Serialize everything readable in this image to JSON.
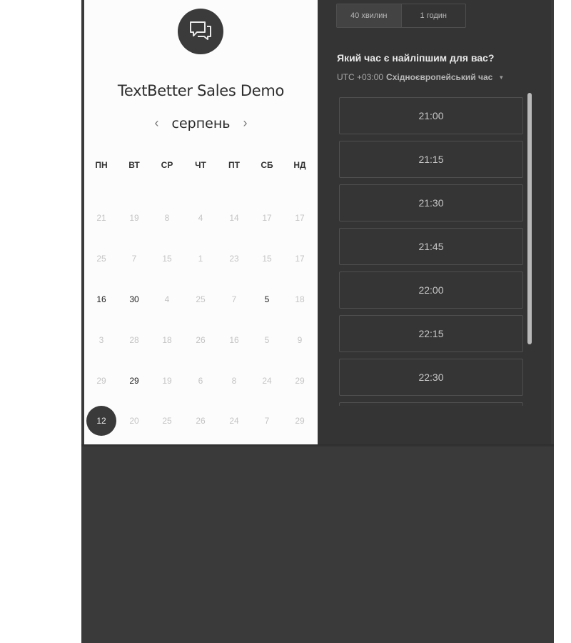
{
  "booking": {
    "company_title": "TextBetter Sales Demo",
    "logo_icon": "chat-bubbles-icon",
    "month": {
      "label": "серпень",
      "prev": "‹",
      "next": "›"
    },
    "weekdays": [
      "ПН",
      "ВТ",
      "СР",
      "ЧТ",
      "ПТ",
      "СБ",
      "НД"
    ],
    "weeks": [
      [
        {
          "d": "21"
        },
        {
          "d": "19"
        },
        {
          "d": "8"
        },
        {
          "d": "4"
        },
        {
          "d": "14"
        },
        {
          "d": "17"
        },
        {
          "d": "17"
        }
      ],
      [
        {
          "d": "25"
        },
        {
          "d": "7"
        },
        {
          "d": "15"
        },
        {
          "d": "1"
        },
        {
          "d": "23"
        },
        {
          "d": "15"
        },
        {
          "d": "17"
        }
      ],
      [
        {
          "d": "16",
          "available": true
        },
        {
          "d": "30",
          "available": true
        },
        {
          "d": "4"
        },
        {
          "d": "25"
        },
        {
          "d": "7"
        },
        {
          "d": "5",
          "available": true
        },
        {
          "d": "18"
        }
      ],
      [
        {
          "d": "3"
        },
        {
          "d": "28"
        },
        {
          "d": "18"
        },
        {
          "d": "26"
        },
        {
          "d": "16"
        },
        {
          "d": "5"
        },
        {
          "d": "9"
        }
      ],
      [
        {
          "d": "29"
        },
        {
          "d": "29",
          "available": true
        },
        {
          "d": "19"
        },
        {
          "d": "6"
        },
        {
          "d": "8"
        },
        {
          "d": "24"
        },
        {
          "d": "29"
        }
      ],
      [
        {
          "d": "12",
          "selected": true
        },
        {
          "d": "20"
        },
        {
          "d": "25"
        },
        {
          "d": "26"
        },
        {
          "d": "24"
        },
        {
          "d": "7"
        },
        {
          "d": "29"
        }
      ]
    ]
  },
  "scheduler": {
    "durations": [
      {
        "label": "40 хвилин",
        "active": true
      },
      {
        "label": "1 годин",
        "active": false
      }
    ],
    "question": "Який час є найліпшим для вас?",
    "timezone": {
      "offset": "UTC +03:00",
      "name": "Східноєвропейський час",
      "caret": "▼"
    },
    "slots": [
      "21:00",
      "21:15",
      "21:30",
      "21:45",
      "22:00",
      "22:15",
      "22:30",
      ""
    ]
  },
  "colors": {
    "panel_dark": "#343434",
    "panel_light": "#fcfcfc",
    "selected_day": "#3a3a3a"
  }
}
